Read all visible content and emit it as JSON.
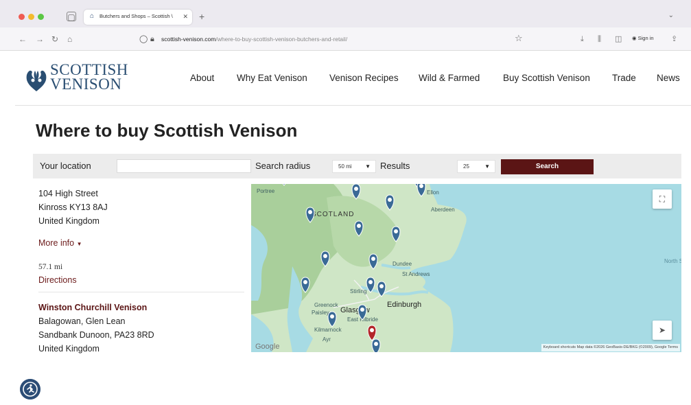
{
  "browser": {
    "tab_title": "Butchers and Shops – Scottish \\",
    "tab_close": "✕",
    "new_tab": "+",
    "tab_list_icon": "chevron-down-icon",
    "url_host": "scottish-venison.com",
    "url_path": "/where-to-buy-scottish-venison-butchers-and-retail/",
    "signin_label": "Sign in"
  },
  "site": {
    "logo_line1": "SCOTTISH",
    "logo_line2": "VENISON",
    "nav": [
      "About",
      "Why Eat Venison",
      "Venison Recipes",
      "Wild & Farmed",
      "Buy Scottish Venison",
      "Trade",
      "News"
    ],
    "page_title": "Where to buy Scottish Venison"
  },
  "search": {
    "location_label": "Your location",
    "location_value": "",
    "radius_label": "Search radius",
    "radius_value": "50 mi",
    "results_label": "Results",
    "results_value": "25",
    "button_label": "Search",
    "accent_color": "#5b1515"
  },
  "listing": {
    "first": {
      "address1": "104 High Street",
      "address2": "Kinross KY13 8AJ",
      "country": "United Kingdom",
      "more_info": "More info",
      "distance": "57.1 mi",
      "directions": "Directions"
    },
    "second": {
      "name": "Winston Churchill Venison",
      "address1": "Balagowan, Glen Lean",
      "address2": "Sandbank Dunoon, PA23 8RD",
      "country": "United Kingdom"
    }
  },
  "map": {
    "labels": {
      "scotland": "SCOTLAND",
      "aberdeen": "Aberdeen",
      "dundee": "Dundee",
      "st_andrews": "St Andrews",
      "edinburgh": "Edinburgh",
      "glasgow": "Glasgow",
      "greenock": "Greenock",
      "paisley": "Paisley",
      "east_kilbride": "East Kilbride",
      "kilmarnock": "Kilmarnock",
      "ayr": "Ayr",
      "stirling": "Stirling",
      "north_sea": "North S",
      "portree": "Portree",
      "ellon": "Ellon"
    },
    "google_mark": "Google",
    "credit": "Keyboard shortcuts   Map data ©2026 GeoBasis-DE/BKG (©2009), Google   Terms",
    "fullscreen_icon": "fullscreen-icon",
    "locate_icon": "my-location-icon"
  },
  "accessibility_icon": "accessibility-icon"
}
